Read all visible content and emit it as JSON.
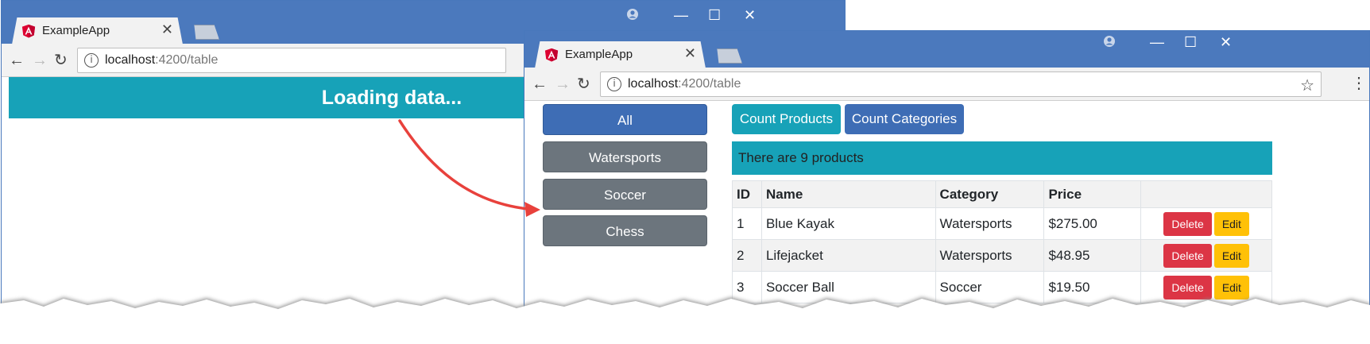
{
  "browser_back": {
    "tab_title": "ExampleApp",
    "url_host": "localhost",
    "url_path": ":4200/table",
    "loading_message": "Loading data..."
  },
  "browser_front": {
    "tab_title": "ExampleApp",
    "url_host": "localhost",
    "url_path": ":4200/table",
    "category_buttons": [
      {
        "label": "All",
        "active": true
      },
      {
        "label": "Watersports",
        "active": false
      },
      {
        "label": "Soccer",
        "active": false
      },
      {
        "label": "Chess",
        "active": false
      }
    ],
    "count_buttons": [
      {
        "label": "Count Products",
        "color": "#17a2b8"
      },
      {
        "label": "Count Categories",
        "color": "#3e6db5"
      }
    ],
    "info_message": "There are 9 products",
    "table": {
      "headers": [
        "ID",
        "Name",
        "Category",
        "Price",
        ""
      ],
      "rows": [
        {
          "id": "1",
          "name": "Blue Kayak",
          "category": "Watersports",
          "price": "$275.00"
        },
        {
          "id": "2",
          "name": "Lifejacket",
          "category": "Watersports",
          "price": "$48.95"
        },
        {
          "id": "3",
          "name": "Soccer Ball",
          "category": "Soccer",
          "price": "$19.50"
        }
      ],
      "delete_label": "Delete",
      "edit_label": "Edit"
    }
  },
  "colors": {
    "titlebar": "#4b79bd",
    "info": "#17a2b8",
    "primary": "#3e6db5",
    "secondary": "#6c757d",
    "danger": "#dc3545",
    "warning": "#ffc107",
    "arrow": "#e8413c"
  },
  "icons": {
    "favicon": "angular-logo-icon",
    "close_tab": "close-icon",
    "back": "back-arrow-icon",
    "forward": "forward-arrow-icon",
    "reload": "reload-icon",
    "info": "info-icon",
    "bookmark": "star-icon",
    "menu": "kebab-menu-icon",
    "profile": "profile-icon",
    "minimize": "minimize-icon",
    "maximize": "maximize-icon",
    "close_window": "close-window-icon"
  }
}
